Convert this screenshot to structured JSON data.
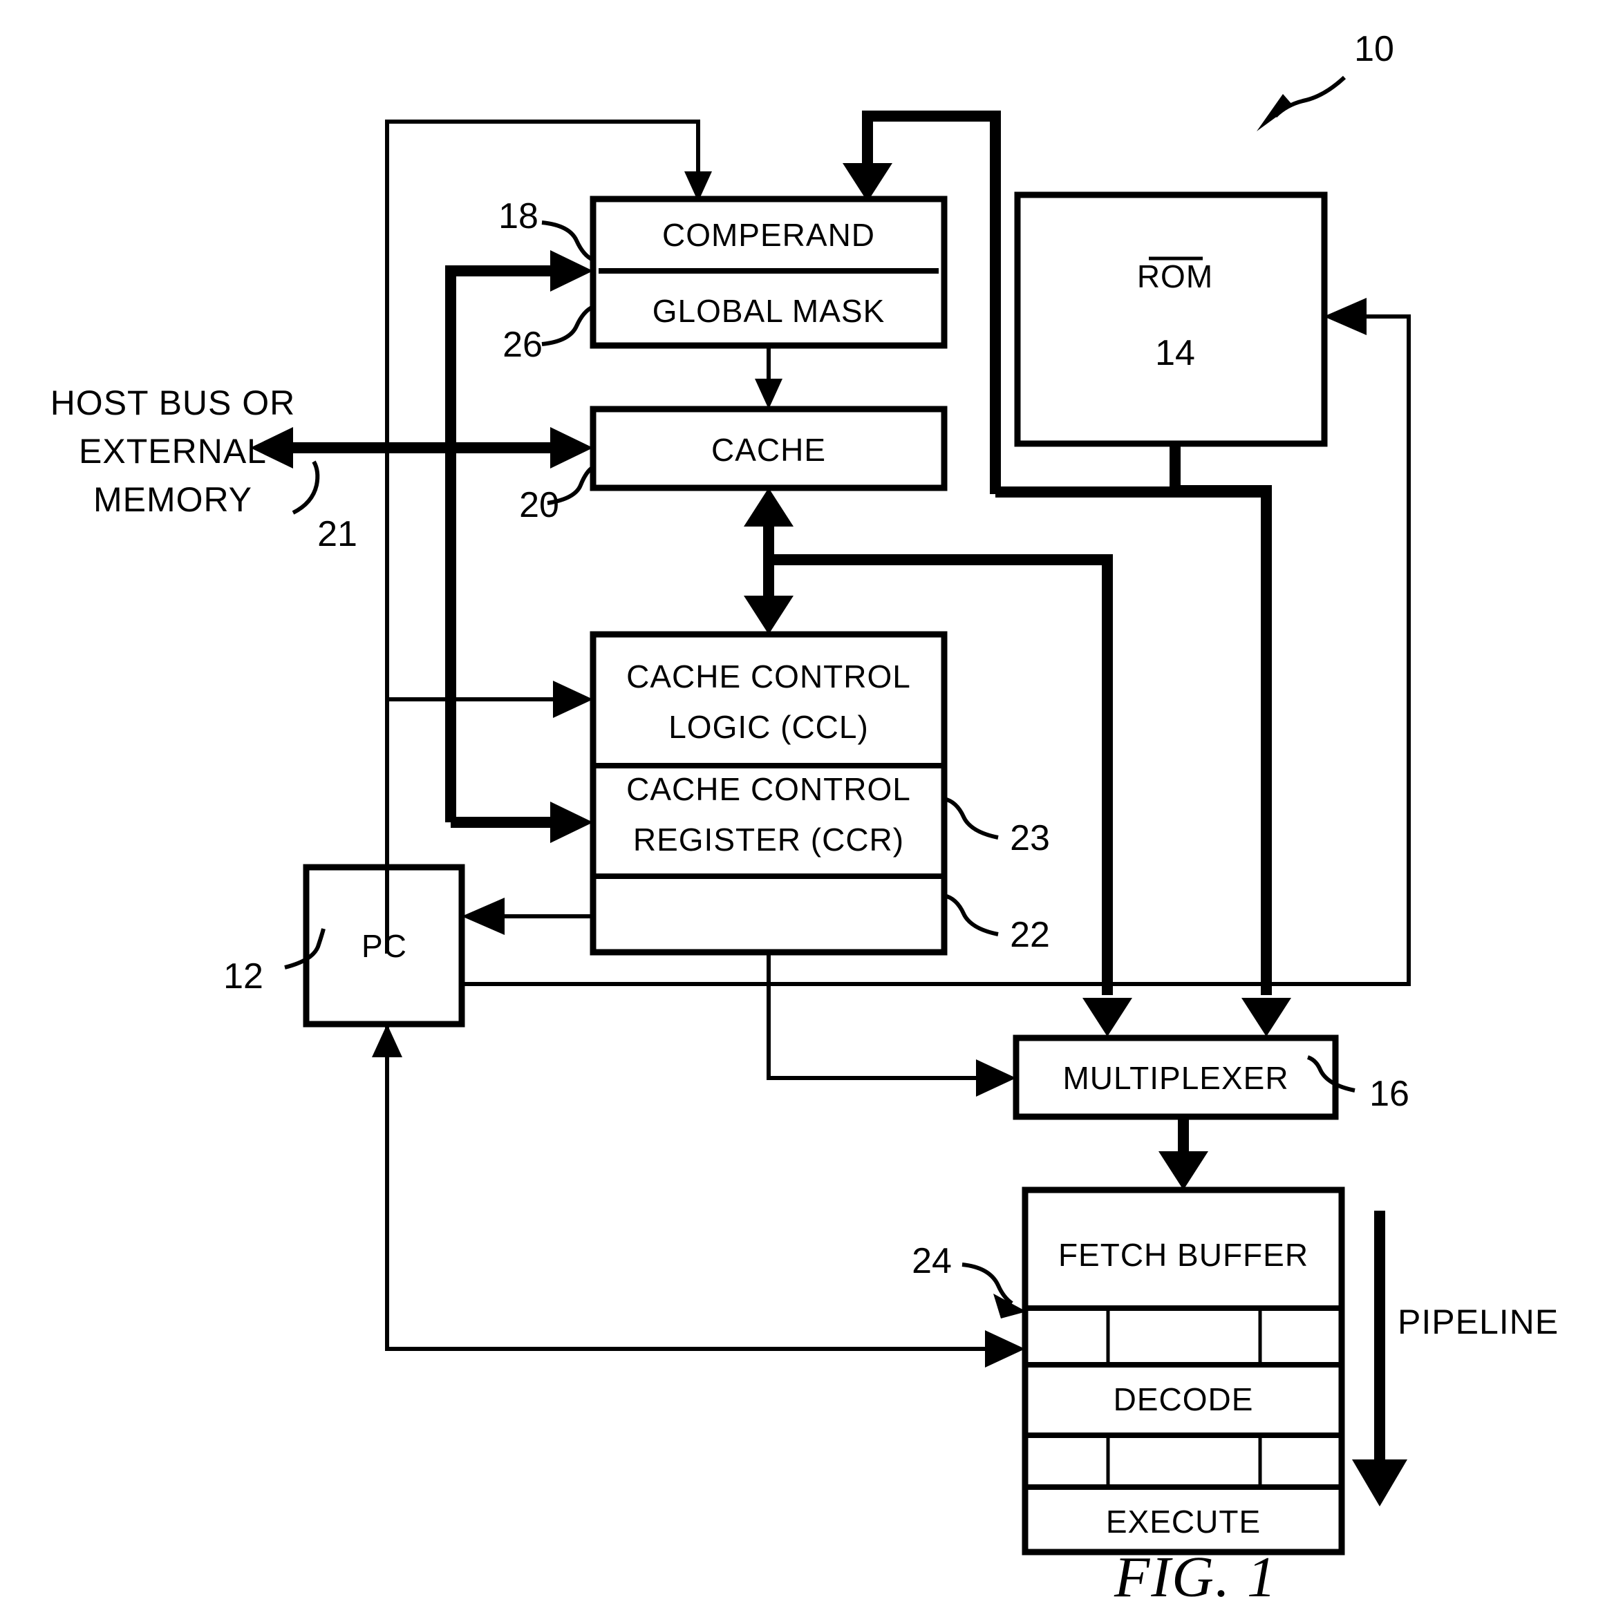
{
  "figure": {
    "caption": "FIG. 1",
    "system_ref": "10"
  },
  "blocks": [
    {
      "id": "comperand",
      "title": "COMPERAND",
      "ref": "18"
    },
    {
      "id": "globalmask",
      "title": "GLOBAL MASK",
      "ref": "26"
    },
    {
      "id": "rom",
      "title": "ROM",
      "ref_inside": "14",
      "ref": ""
    },
    {
      "id": "cache",
      "title": "CACHE",
      "ref": "20"
    },
    {
      "id": "ccl",
      "title": "CACHE CONTROL",
      "title2": "LOGIC (CCL)",
      "ref": ""
    },
    {
      "id": "ccr",
      "title": "CACHE CONTROL",
      "title2": "REGISTER (CCR)",
      "ref": "23"
    },
    {
      "id": "ccx",
      "title": "",
      "ref": "22"
    },
    {
      "id": "pc",
      "title": "PC",
      "ref": "12"
    },
    {
      "id": "mux",
      "title": "MULTIPLEXER",
      "ref": "16"
    },
    {
      "id": "fetch",
      "title": "FETCH BUFFER",
      "ref": "24"
    },
    {
      "id": "decode",
      "title": "DECODE",
      "ref": ""
    },
    {
      "id": "execute",
      "title": "EXECUTE",
      "ref": ""
    }
  ],
  "labels": {
    "host_bus_line1": "HOST BUS OR",
    "host_bus_line2": "EXTERNAL",
    "host_bus_line3": "MEMORY",
    "host_bus_ref": "21",
    "pipeline": "PIPELINE"
  },
  "refs": {
    "ten": "10",
    "twelve": "12",
    "fourteen": "14",
    "sixteen": "16",
    "eighteen": "18",
    "twenty": "20",
    "twentyone": "21",
    "twentytwo": "22",
    "twentythree": "23",
    "twentyfour": "24",
    "twentysix": "26"
  },
  "colors": {
    "ink": "#000000",
    "paper": "#ffffff"
  }
}
